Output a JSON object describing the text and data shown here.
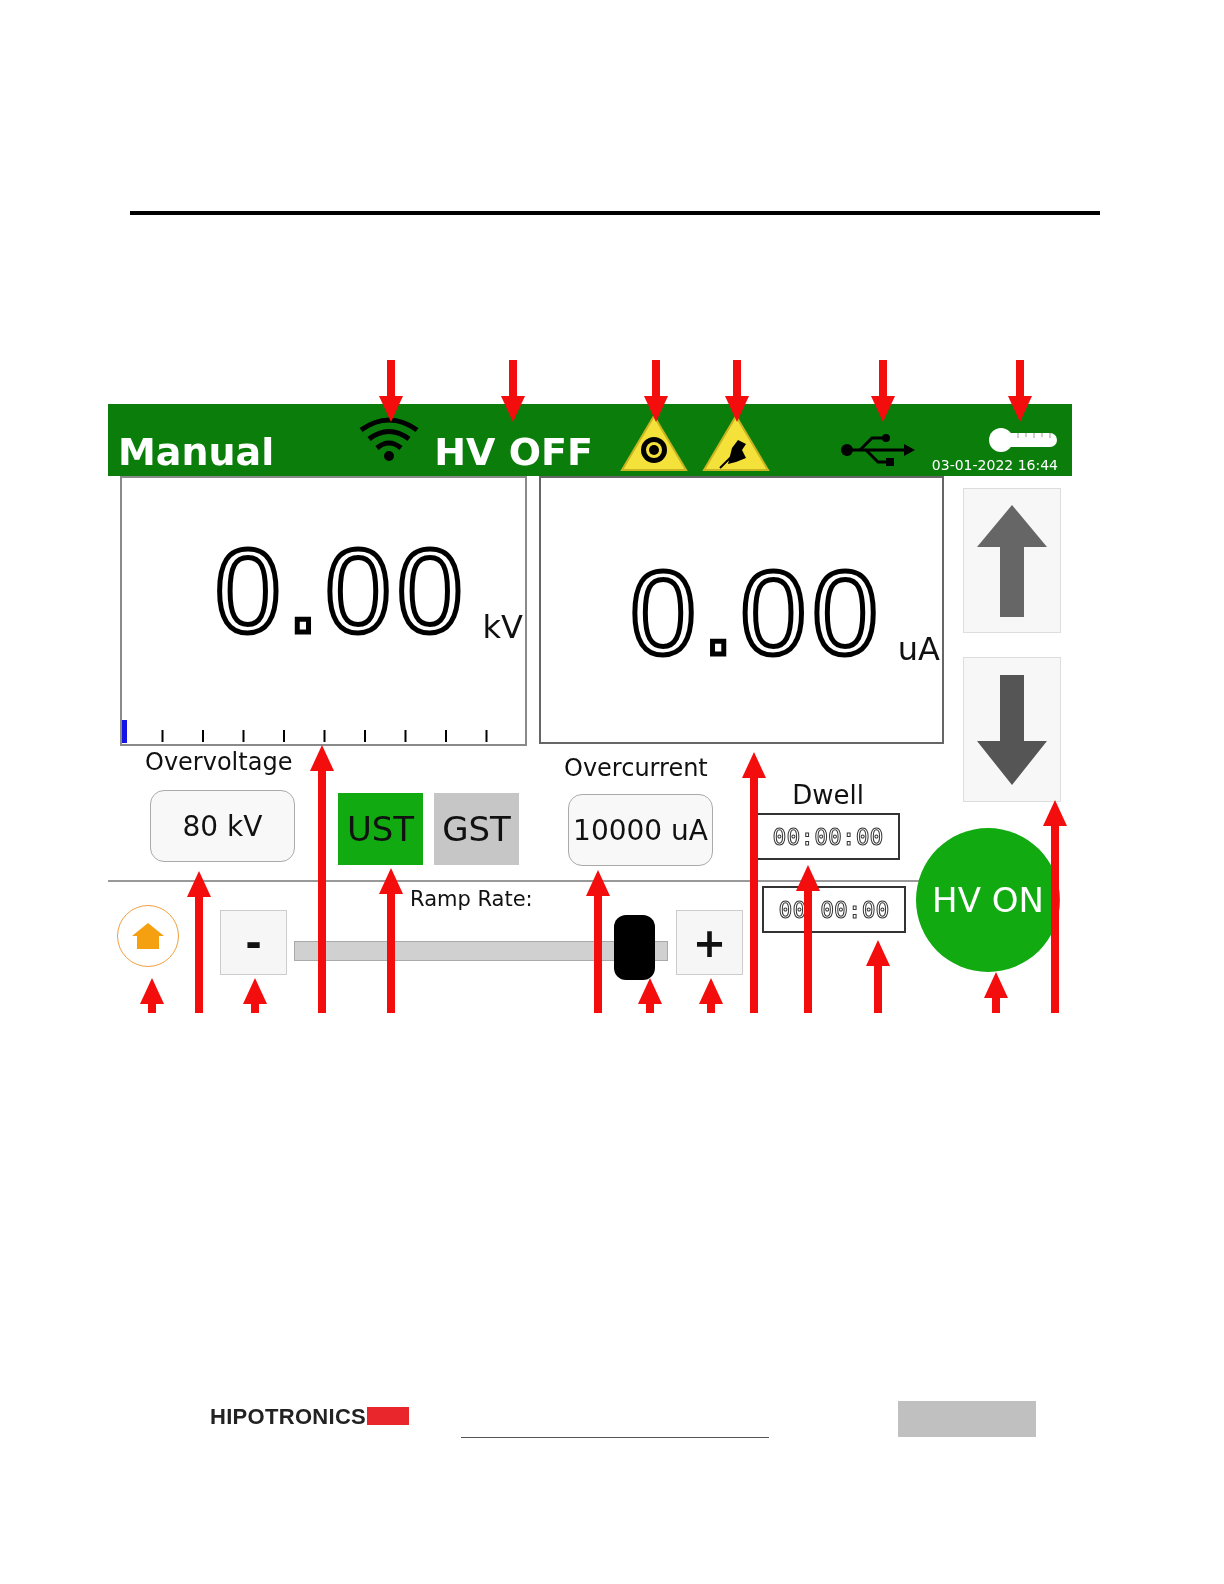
{
  "header": {
    "mode": "Manual",
    "hv_status": "HV OFF",
    "datetime": "03-01-2022 16:44"
  },
  "voltage_meter": {
    "reading": "0.00",
    "unit": "kV",
    "level": 0
  },
  "current_meter": {
    "reading": "0.00",
    "unit": "uA"
  },
  "overvoltage": {
    "label": "Overvoltage",
    "value": "80 kV"
  },
  "modes": [
    {
      "label": "UST",
      "selected": true
    },
    {
      "label": "GST",
      "selected": false
    }
  ],
  "overcurrent": {
    "label": "Overcurrent",
    "value": "10000 uA"
  },
  "dwell": {
    "label": "Dwell",
    "set_time": "00:00:00",
    "elapsed_time": "00 00:00"
  },
  "ramp_rate": {
    "label": "Ramp Rate:",
    "minus": "-",
    "plus": "+",
    "level": 0.96
  },
  "hv_on_button": "HV ON",
  "footer": {
    "logo": "HIPOTRONICS"
  }
}
